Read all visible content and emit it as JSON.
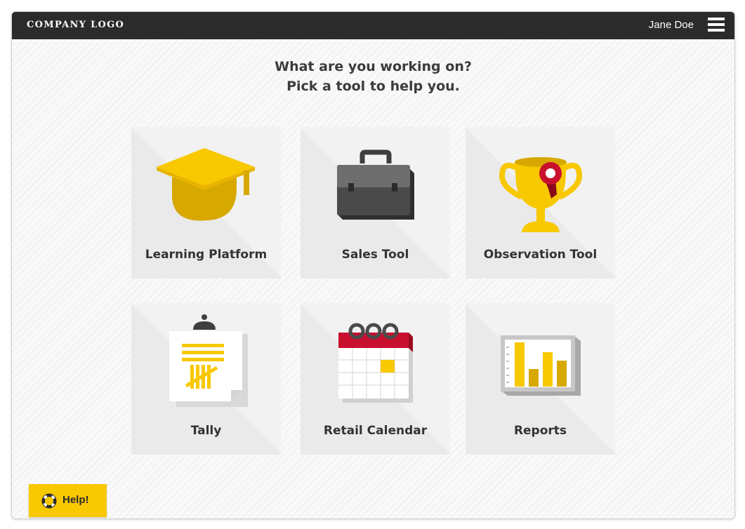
{
  "header": {
    "logo_text": "COMPANY LOGO",
    "user_name": "Jane Doe",
    "menu_icon": "hamburger-menu-icon"
  },
  "intro": {
    "line1": "What are you working on?",
    "line2": "Pick a tool to help you."
  },
  "tools": [
    {
      "label": "Learning Platform",
      "icon": "graduation-cap-icon"
    },
    {
      "label": "Sales Tool",
      "icon": "briefcase-icon"
    },
    {
      "label": "Observation Tool",
      "icon": "trophy-icon"
    },
    {
      "label": "Tally",
      "icon": "clipboard-tally-icon"
    },
    {
      "label": "Retail Calendar",
      "icon": "calendar-icon"
    },
    {
      "label": "Reports",
      "icon": "bar-chart-icon"
    }
  ],
  "help": {
    "label": "Help!",
    "icon": "lifebuoy-icon"
  },
  "colors": {
    "accent": "#f8c800",
    "accent_dark": "#d6a800",
    "header_bg": "#2b2b2b",
    "calendar_red": "#c8102e"
  }
}
